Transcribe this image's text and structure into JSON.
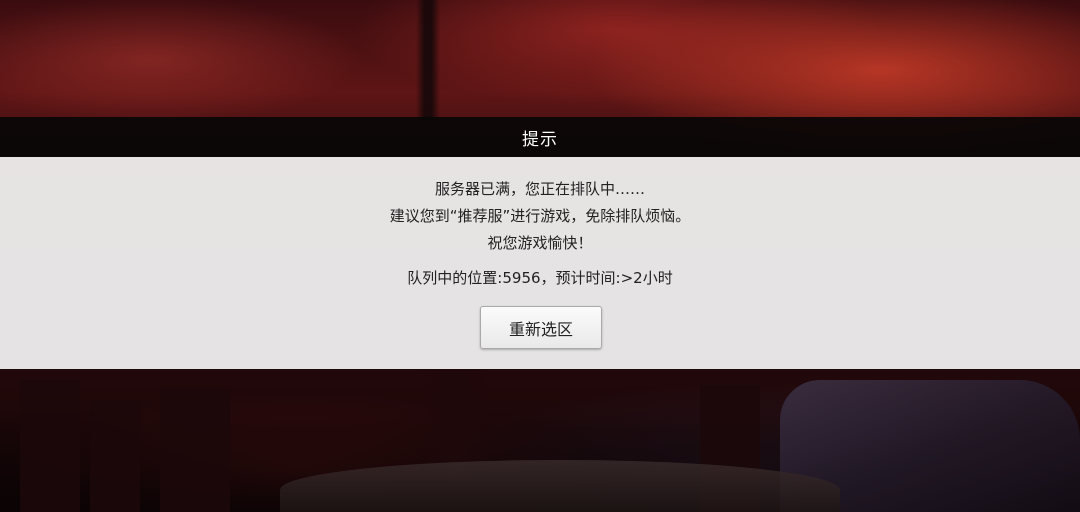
{
  "dialog": {
    "title": "提示",
    "message_lines": [
      "服务器已满，您正在排队中……",
      "建议您到“推荐服”进行游戏，免除排队烦恼。",
      "祝您游戏愉快！"
    ],
    "queue_info": "队列中的位置:5956，预计时间:>2小时",
    "reselect_button_label": "重新选区"
  },
  "colors": {
    "title_bar_bg": "#080606",
    "dialog_bg": "#f0efef",
    "text": "#222222"
  }
}
